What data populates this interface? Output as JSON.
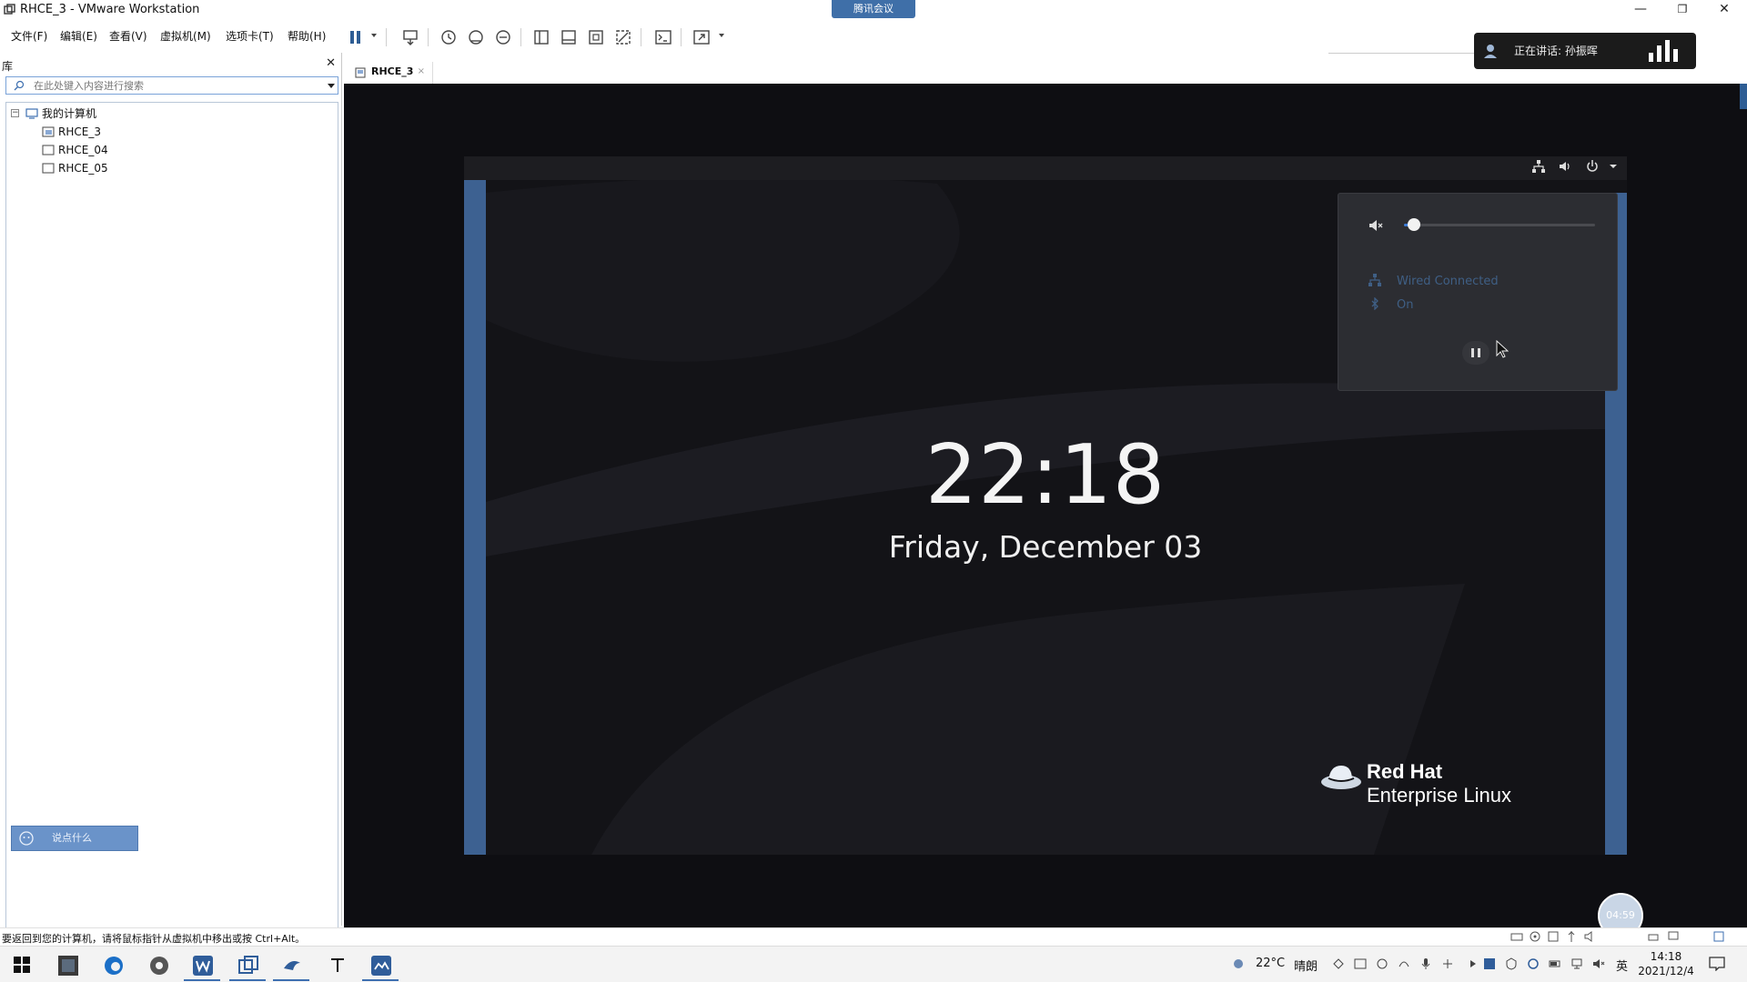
{
  "window": {
    "title": "RHCE_3 - VMware Workstation",
    "meeting_badge": "腾讯会议",
    "minimize": "—",
    "maximize": "❐",
    "close": "✕"
  },
  "menu": {
    "items": [
      "文件(F)",
      "编辑(E)",
      "查看(V)",
      "虚拟机(M)",
      "选项卡(T)",
      "帮助(H)"
    ]
  },
  "talk_widget": {
    "text": "正在讲话: 孙振晖"
  },
  "sidebar": {
    "header": "库",
    "close": "✕",
    "search_placeholder": "在此处键入内容进行搜索",
    "tree_root": "我的计算机",
    "vms": [
      "RHCE_3",
      "RHCE_04",
      "RHCE_05"
    ],
    "ask_button": "说点什么"
  },
  "vm_tab": {
    "label": "RHCE_3",
    "close": "×"
  },
  "guest": {
    "time": "22:18",
    "date": "Friday, December 03",
    "brand_line1": "Red Hat",
    "brand_line2": "Enterprise Linux",
    "status_menu": {
      "volume_level": 0.05,
      "network": "Wired Connected",
      "bluetooth": "On"
    }
  },
  "recording_bubble": "04:59",
  "statusbar": {
    "message": "要返回到您的计算机，请将鼠标指针从虚拟机中移出或按 Ctrl+Alt。"
  },
  "taskbar": {
    "weather_temp": "22°C",
    "weather_desc": "晴朗",
    "ime": "英",
    "time": "14:18",
    "date": "2021/12/4"
  },
  "colors": {
    "accent": "#3d6fb0",
    "vm_side": "#3d6191",
    "guest_bg": "#131317",
    "slider_fill": "#3d7bd6"
  }
}
